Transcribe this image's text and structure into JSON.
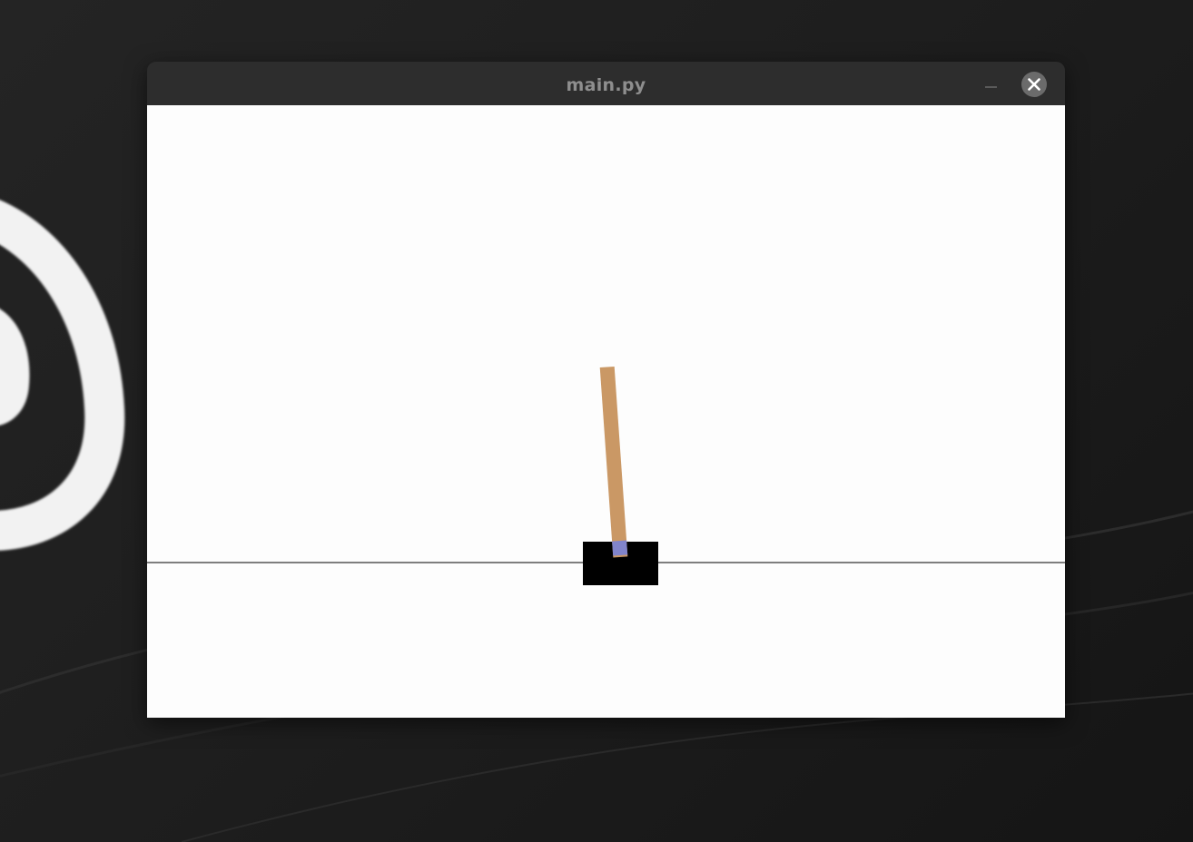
{
  "window": {
    "title": "main.py",
    "controls": {
      "minimize_icon": "minimize-icon",
      "close_icon": "close-icon"
    }
  },
  "scene": {
    "environment": "CartPole",
    "colors": {
      "background": "#fdfdfd",
      "track": "#000000",
      "cart": "#000000",
      "pole": "#ca9865",
      "axle": "#8184cb"
    },
    "pole_angle_deg": -4
  },
  "desktop": {
    "background_color": "#1c1c1c",
    "decoration_icon": "wallpaper-swirl"
  }
}
